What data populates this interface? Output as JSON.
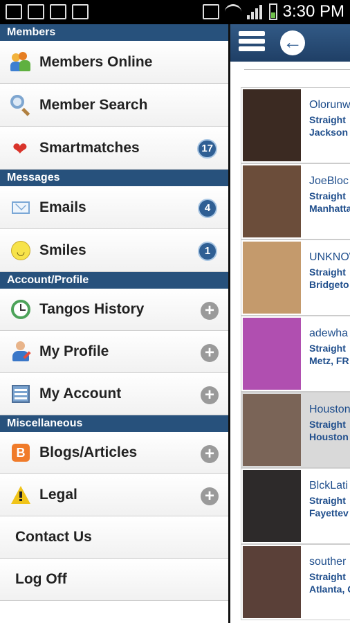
{
  "status_bar": {
    "time": "3:30 PM"
  },
  "background_app": {
    "members": [
      {
        "name": "Olorunw",
        "orientation": "Straight",
        "location": "Jackson"
      },
      {
        "name": "JoeBloc",
        "orientation": "Straight",
        "location": "Manhatta"
      },
      {
        "name": "UNKNOW",
        "orientation": "Straight",
        "location": "Bridgeto"
      },
      {
        "name": "adewha",
        "orientation": "Straight",
        "location": "Metz, FR"
      },
      {
        "name": "Houston",
        "orientation": "Straight",
        "location": "Houston"
      },
      {
        "name": "BlckLati",
        "orientation": "Straight",
        "location": "Fayettev"
      },
      {
        "name": "souther",
        "orientation": "Straight",
        "location": "Atlanta, G"
      }
    ]
  },
  "drawer": {
    "sections": [
      {
        "title": "Members",
        "items": [
          {
            "label": "Members Online",
            "icon": "members-online-icon"
          },
          {
            "label": "Member Search",
            "icon": "magnifier-icon"
          },
          {
            "label": "Smartmatches",
            "icon": "heart-icon",
            "badge": "17"
          }
        ]
      },
      {
        "title": "Messages",
        "items": [
          {
            "label": "Emails",
            "icon": "envelope-icon",
            "badge": "4"
          },
          {
            "label": "Smiles",
            "icon": "smiley-icon",
            "badge": "1"
          }
        ]
      },
      {
        "title": "Account/Profile",
        "items": [
          {
            "label": "Tangos History",
            "icon": "clock-icon"
          },
          {
            "label": "My Profile",
            "icon": "user-edit-icon"
          },
          {
            "label": "My Account",
            "icon": "account-icon"
          }
        ]
      },
      {
        "title": "Miscellaneous",
        "items": [
          {
            "label": "Blogs/Articles",
            "icon": "blogger-icon"
          },
          {
            "label": "Legal",
            "icon": "warning-icon"
          },
          {
            "label": "Contact Us"
          },
          {
            "label": "Log Off"
          }
        ]
      }
    ]
  },
  "colors": {
    "section_header": "#27517c",
    "badge": "#2f5f94",
    "link": "#1f4e8c"
  }
}
